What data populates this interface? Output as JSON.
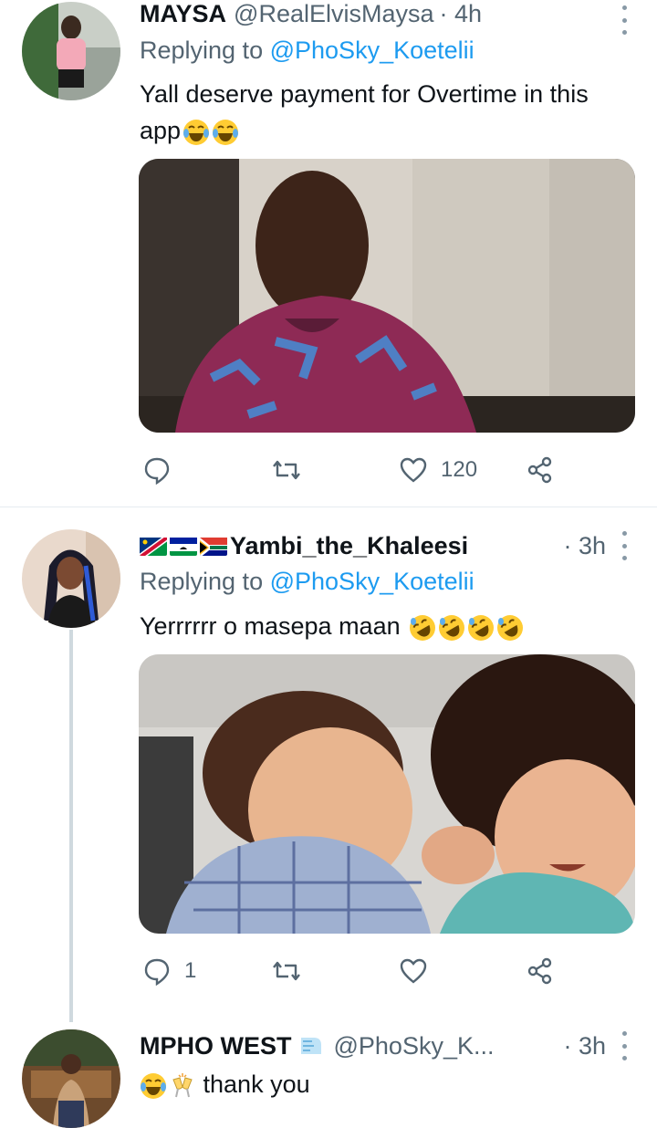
{
  "tweets": [
    {
      "name": "MAYSA",
      "handle": "@RealElvisMaysa",
      "time": "· 4h",
      "replying_label": "Replying to",
      "replying_to": "@PhoSky_Koetelii",
      "text": "Yall deserve payment for Overtime in this app",
      "emojis": [
        "joy-emoji",
        "joy-emoji"
      ],
      "actions": {
        "reply": "",
        "retweet": "",
        "like": "120",
        "share": ""
      }
    },
    {
      "name": "Yambi_the_Khaleesi",
      "flags": [
        "namibia-flag",
        "lesotho-flag",
        "south-africa-flag"
      ],
      "time": "· 3h",
      "replying_label": "Replying to",
      "replying_to": "@PhoSky_Koetelii",
      "text": "Yerrrrrr o masepa maan",
      "emojis": [
        "rofl-emoji",
        "rofl-emoji",
        "rofl-emoji",
        "rofl-emoji"
      ],
      "actions": {
        "reply": "1",
        "retweet": "",
        "like": "",
        "share": ""
      }
    },
    {
      "name": "MPHO WEST",
      "handle": "@PhoSky_K...",
      "time": "· 3h",
      "text": "thank you",
      "emojis": [
        "joy-emoji",
        "clinking-glasses-emoji"
      ]
    }
  ],
  "colors": {
    "accent": "#1d9bf0",
    "secondary_text": "#536471",
    "divider": "#e6ecf0"
  }
}
